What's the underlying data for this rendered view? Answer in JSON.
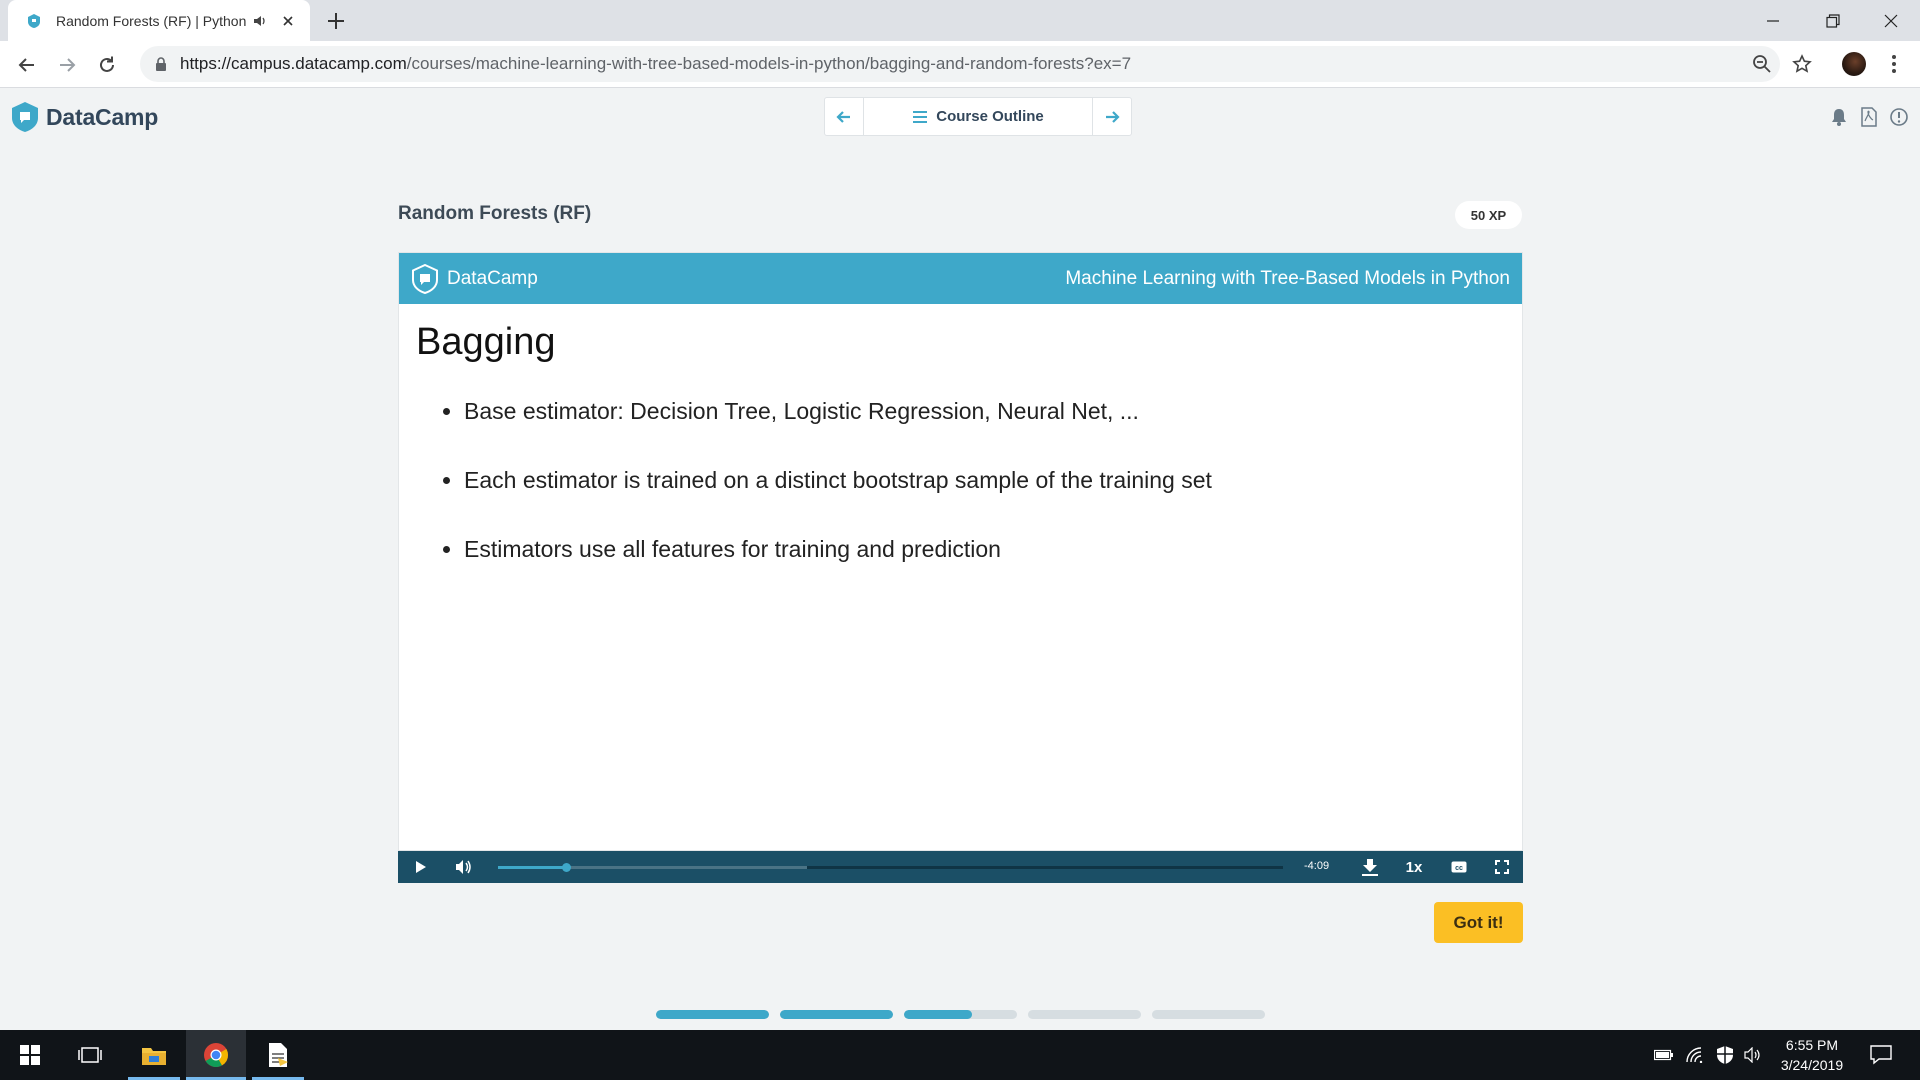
{
  "browser": {
    "tab_title": "Random Forests (RF) | Python",
    "url_host": "https://campus.datacamp.com",
    "url_path": "/courses/machine-learning-with-tree-based-models-in-python/bagging-and-random-forests?ex=7"
  },
  "header": {
    "brand": "DataCamp",
    "course_outline_label": "Course Outline"
  },
  "exercise": {
    "title": "Random Forests (RF)",
    "xp": "50 XP",
    "got_it_label": "Got it!"
  },
  "slide": {
    "brand": "DataCamp",
    "course_name": "Machine Learning with Tree-Based Models in Python",
    "heading": "Bagging",
    "bullets": [
      "Base estimator: Decision Tree, Logistic Regression, Neural Net, ...",
      "Each estimator is trained on a distinct bootstrap sample of the training set",
      "Estimators use all features for training and prediction"
    ]
  },
  "video": {
    "time_remaining": "-4:09",
    "speed": "1x",
    "played_fraction": 0.086,
    "buffered_fraction": 0.393
  },
  "lesson_progress": [
    1,
    1,
    0.6,
    0,
    0
  ],
  "taskbar": {
    "time": "6:55 PM",
    "date": "3/24/2019"
  },
  "colors": {
    "accent": "#3ea8c9",
    "video_bar": "#1b4f66",
    "got_it": "#fbbf24"
  }
}
